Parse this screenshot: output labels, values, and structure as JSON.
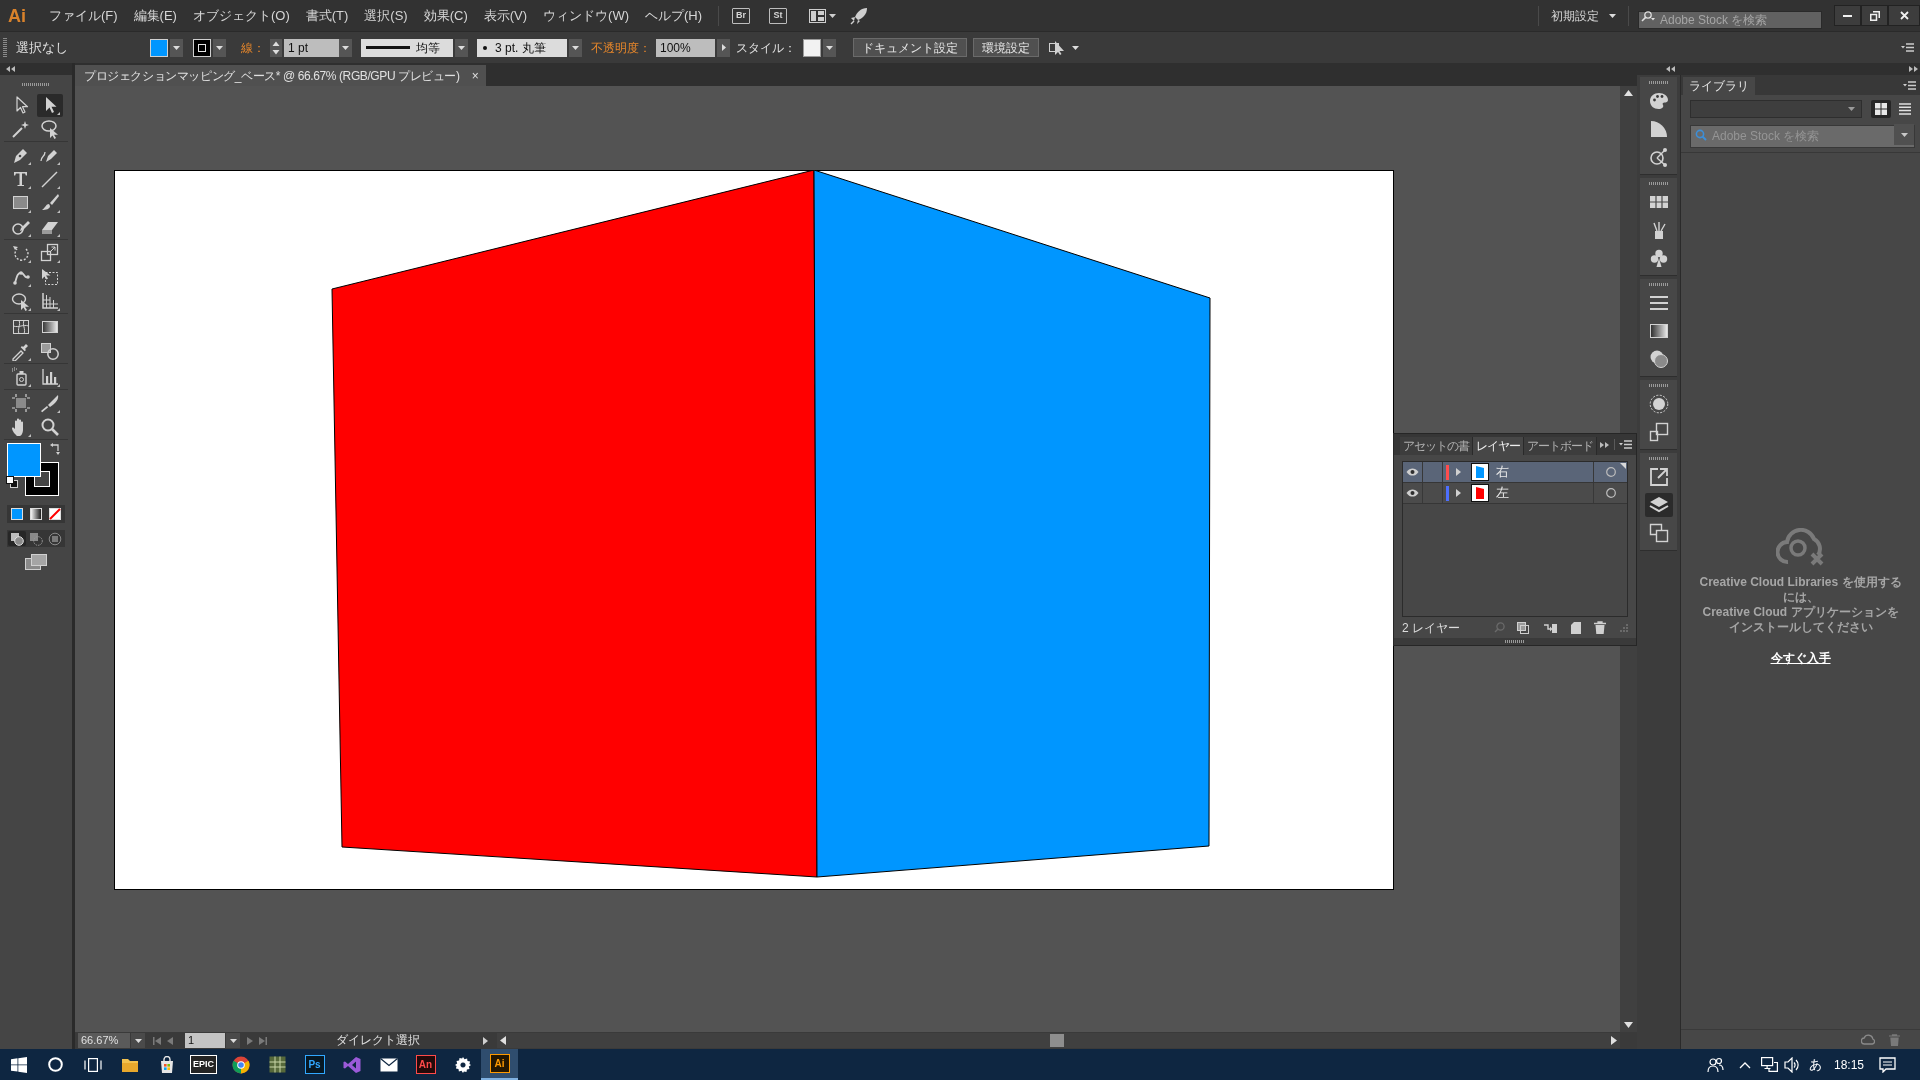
{
  "menu_bar": {
    "logo": "Ai",
    "menus": [
      "ファイル(F)",
      "編集(E)",
      "オブジェクト(O)",
      "書式(T)",
      "選択(S)",
      "効果(C)",
      "表示(V)",
      "ウィンドウ(W)",
      "ヘルプ(H)"
    ],
    "badges": [
      "Br",
      "St"
    ],
    "workspace": "初期設定",
    "search": {
      "placeholder": "Adobe Stock を検索"
    }
  },
  "control_bar": {
    "selection": "選択なし",
    "fill": {
      "color": "#0096ff"
    },
    "stroke": {
      "color": "#000000"
    },
    "stroke_label": "線：",
    "stroke_weight": "1 pt",
    "profile": "均等",
    "brush": "3 pt. 丸筆",
    "opacity_label": "不透明度：",
    "opacity": "100%",
    "style_label": "スタイル：",
    "buttons": [
      "ドキュメント設定",
      "環境設定"
    ]
  },
  "tool_panel": {
    "tool_groups": [
      {
        "tools": [
          {
            "kind": "selection",
            "selected": false
          },
          {
            "kind": "direct-selection",
            "selected": true
          },
          {
            "kind": "magic-wand",
            "selected": false
          },
          {
            "kind": "lasso",
            "selected": false
          }
        ]
      },
      {
        "tools": [
          {
            "kind": "pen",
            "selected": false
          },
          {
            "kind": "curvature",
            "selected": false
          },
          {
            "kind": "type",
            "selected": false
          },
          {
            "kind": "line",
            "selected": false
          },
          {
            "kind": "rectangle",
            "selected": false
          },
          {
            "kind": "paintbrush",
            "selected": false
          },
          {
            "kind": "shaper",
            "selected": false
          },
          {
            "kind": "eraser",
            "selected": false
          }
        ]
      },
      {
        "tools": [
          {
            "kind": "rotate",
            "selected": false
          },
          {
            "kind": "scale",
            "selected": false
          },
          {
            "kind": "warp",
            "selected": false
          },
          {
            "kind": "free-transform",
            "selected": false
          },
          {
            "kind": "shape-builder",
            "selected": false
          },
          {
            "kind": "perspective",
            "selected": false
          }
        ]
      },
      {
        "tools": [
          {
            "kind": "mesh",
            "selected": false
          },
          {
            "kind": "gradient",
            "selected": false
          },
          {
            "kind": "eyedropper",
            "selected": false
          },
          {
            "kind": "blend",
            "selected": false
          }
        ]
      },
      {
        "tools": [
          {
            "kind": "symbol-sprayer",
            "selected": false
          },
          {
            "kind": "column-graph",
            "selected": false
          }
        ]
      },
      {
        "tools": [
          {
            "kind": "artboard",
            "selected": false
          },
          {
            "kind": "slice",
            "selected": false
          },
          {
            "kind": "hand",
            "selected": false
          },
          {
            "kind": "zoom",
            "selected": false
          }
        ]
      }
    ],
    "fill": {
      "color": "#0096ff"
    },
    "stroke": {
      "color": "#000000"
    },
    "draw_modes": [
      {
        "kind": "normal",
        "selected": true
      },
      {
        "kind": "behind",
        "selected": false
      },
      {
        "kind": "inside",
        "selected": false
      }
    ]
  },
  "document_tab": {
    "title": "プロジェクションマッピング_ベース* @ 66.67% (RGB/GPU プレビュー)",
    "close": "×"
  },
  "artwork": {
    "shapes": [
      {
        "kind": "left-face",
        "color": "#ff0000"
      },
      {
        "kind": "right-face",
        "color": "#0096ff"
      }
    ]
  },
  "layers_panel": {
    "tabs": [
      {
        "label": "アセットの書",
        "selected": false
      },
      {
        "label": "レイヤー",
        "selected": true
      },
      {
        "label": "アートボード",
        "selected": false
      }
    ],
    "layers": [
      {
        "name": "右",
        "visible": true,
        "expanded": false,
        "selected": true,
        "color": "#ff4d4d",
        "thumbnail": {
          "color": "#0096ff"
        }
      },
      {
        "name": "左",
        "visible": true,
        "expanded": false,
        "selected": false,
        "color": "#4d6fff",
        "thumbnail": {
          "color": "#ff0000"
        }
      }
    ],
    "count": "2 レイヤー"
  },
  "dock": {
    "groups": [
      {
        "icons": [
          {
            "kind": "color",
            "selected": false
          },
          {
            "kind": "color-guide",
            "selected": false
          },
          {
            "kind": "properties",
            "selected": false
          }
        ]
      },
      {
        "icons": [
          {
            "kind": "swatches",
            "selected": false
          },
          {
            "kind": "brushes",
            "selected": false
          },
          {
            "kind": "symbols",
            "selected": false
          }
        ]
      },
      {
        "icons": [
          {
            "kind": "stroke",
            "selected": false
          },
          {
            "kind": "gradient",
            "selected": false
          },
          {
            "kind": "transparency",
            "selected": false
          }
        ]
      },
      {
        "icons": [
          {
            "kind": "appearance",
            "selected": false
          },
          {
            "kind": "graphic-styles",
            "selected": false
          }
        ]
      },
      {
        "icons": [
          {
            "kind": "export",
            "selected": false
          },
          {
            "kind": "layers",
            "selected": true
          },
          {
            "kind": "artboards",
            "selected": false
          }
        ]
      }
    ]
  },
  "library_panel": {
    "tabs": [
      {
        "label": "ライブラリ",
        "selected": true
      }
    ],
    "views": [
      {
        "kind": "grid",
        "selected": true
      },
      {
        "kind": "list",
        "selected": false
      }
    ],
    "search": {
      "placeholder": "Adobe Stock を検索"
    },
    "message": "Creative Cloud Libraries を使用するには、\nCreative Cloud アプリケーションをインストールしてください",
    "link": "今すぐ入手"
  },
  "status_bar": {
    "zoom": "66.67%",
    "artboard": "1",
    "status": "ダイレクト選択"
  },
  "taskbar": {
    "apps": [
      {
        "kind": "explorer",
        "selected": false
      },
      {
        "kind": "store",
        "selected": false
      },
      {
        "kind": "letter-tile",
        "label": "EPIC",
        "color": "#ffffff",
        "selected": false
      },
      {
        "kind": "browser",
        "selected": false
      },
      {
        "kind": "grid-app",
        "selected": false
      },
      {
        "kind": "letter-tile",
        "label": "Ps",
        "color": "#31a8ff",
        "selected": false
      },
      {
        "kind": "ribbon",
        "selected": false
      },
      {
        "kind": "mail",
        "selected": false
      },
      {
        "kind": "letter-tile",
        "label": "An",
        "color": "#ff4a4a",
        "selected": false
      },
      {
        "kind": "settings",
        "selected": false
      },
      {
        "kind": "letter-tile",
        "label": "Ai",
        "color": "#ff9a00",
        "selected": true
      }
    ],
    "ime": "あ",
    "time": "18:15"
  }
}
